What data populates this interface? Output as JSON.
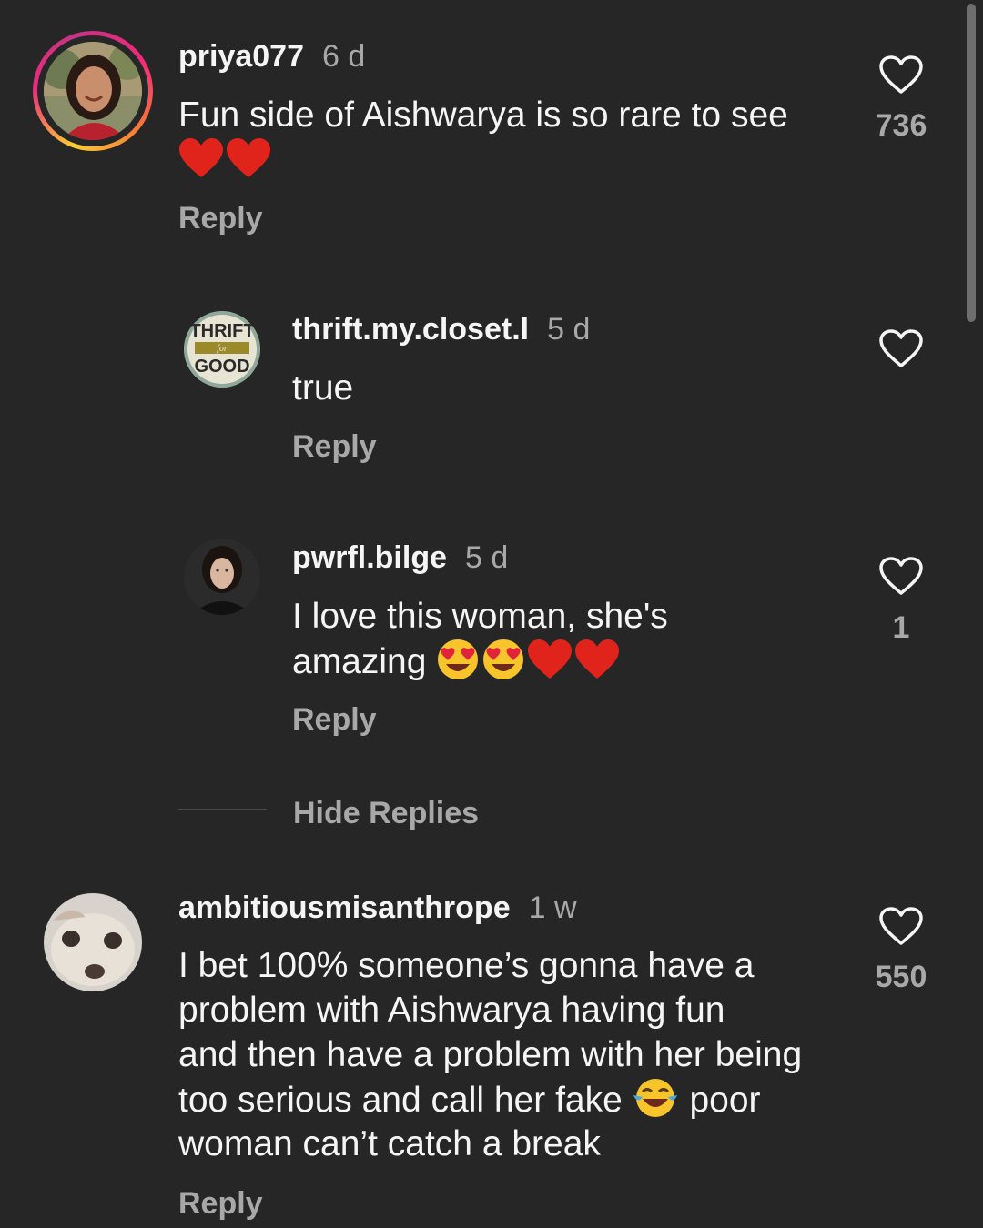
{
  "comments": [
    {
      "username": "priya077",
      "time": "6 d",
      "text": "Fun side of Aishwarya is so rare to see",
      "emojis": [
        "red-heart-emoji",
        "red-heart-emoji"
      ],
      "reply_label": "Reply",
      "like_count": "736",
      "has_story_ring": true
    },
    {
      "username": "thrift.my.closet.l",
      "time": "5 d",
      "text": "true",
      "reply_label": "Reply",
      "like_count": "",
      "avatar_logo": {
        "top": "THRIFT",
        "middle": "for",
        "bottom": "GOOD"
      }
    },
    {
      "username": "pwrfl.bilge",
      "time": "5 d",
      "text_line1": "I love this woman, she's",
      "text_line2": "amazing",
      "emojis": [
        "heart-eyes-emoji",
        "heart-eyes-emoji",
        "red-heart-emoji",
        "red-heart-emoji"
      ],
      "reply_label": "Reply",
      "like_count": "1"
    },
    {
      "username": "ambitiousmisanthrope",
      "time": "1 w",
      "text_line1": "I bet 100% someone’s gonna have a",
      "text_line2": "problem with Aishwarya having fun",
      "text_line3": "and then have a problem with her being",
      "text_line4a": "too serious and call her fake",
      "text_line4b": "poor",
      "text_line5": "woman can’t catch a break",
      "emojis": [
        "tears-of-joy-emoji"
      ],
      "reply_label": "Reply",
      "like_count": "550"
    }
  ],
  "hide_replies_label": "Hide Replies",
  "colors": {
    "background": "#262626",
    "primary_text": "#f5f5f5",
    "secondary_text": "#a8a8a8",
    "heart_red": "#e0241b"
  }
}
